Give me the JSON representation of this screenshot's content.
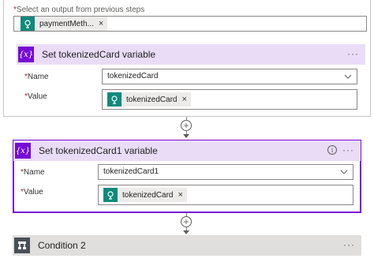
{
  "previous": {
    "label_required": "*",
    "label": "Select an output from previous steps",
    "token": "paymentMeth...",
    "remove": "×"
  },
  "action1": {
    "title": "Set tokenizedCard variable",
    "icon": "{x}",
    "more": "···",
    "name_label": "Name",
    "name_value": "tokenizedCard",
    "value_label": "Value",
    "value_token": "tokenizedCard",
    "remove": "×"
  },
  "action2": {
    "title": "Set tokenizedCard1 variable",
    "icon": "{x}",
    "info": "i",
    "more": "···",
    "name_label": "Name",
    "name_value": "tokenizedCard1",
    "value_label": "Value",
    "value_token": "tokenizedCard",
    "remove": "×"
  },
  "condition": {
    "title": "Condition 2",
    "more": "···"
  },
  "required_marker": "*",
  "colors": {
    "variable_accent": "#770bd6",
    "variable_header": "#eadcf7",
    "token_icon": "#0f8a7c",
    "condition_header": "#e1dfdd",
    "required": "#a4262c"
  }
}
